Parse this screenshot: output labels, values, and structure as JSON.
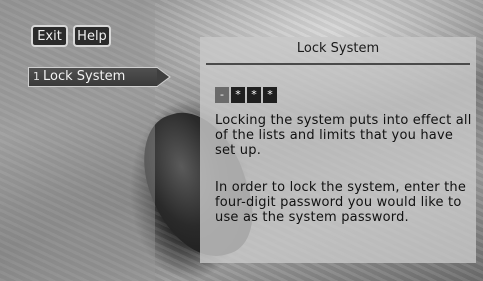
{
  "toolbar": {
    "exit_label": "Exit",
    "help_label": "Help"
  },
  "menu": {
    "items": [
      {
        "number": "1",
        "label": "Lock System"
      }
    ]
  },
  "panel": {
    "title": "Lock System",
    "password_boxes": [
      "-",
      "*",
      "*",
      "*"
    ],
    "paragraph1": "Locking the system puts into effect all of the lists and limits that you have set up.",
    "paragraph2": "In order to lock the system, enter the four-digit password you would like to use as the system password."
  },
  "colors": {
    "button_bg": "#2b2b2b",
    "panel_bg": "#c8c8c8",
    "text": "#111111"
  }
}
